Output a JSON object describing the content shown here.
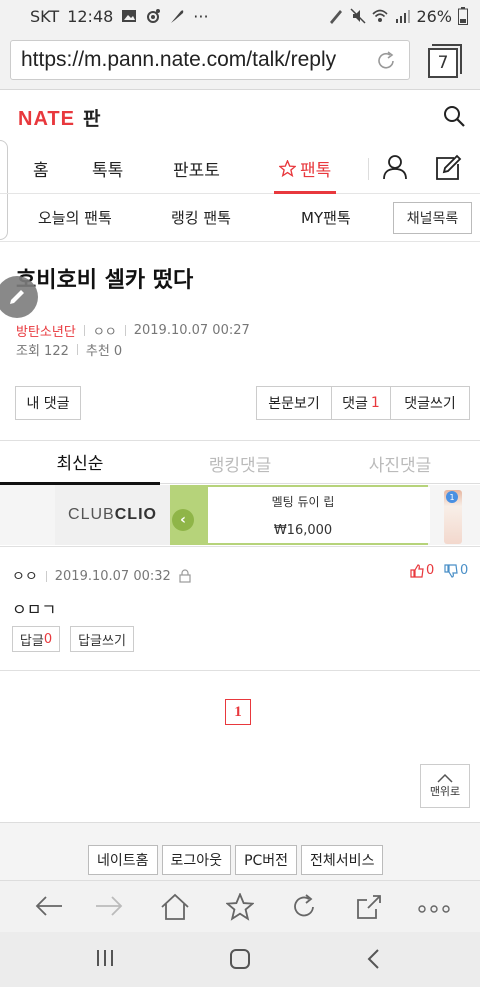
{
  "status_bar": {
    "carrier": "SKT",
    "time": "12:48",
    "more": "···",
    "battery": "26%"
  },
  "browser": {
    "url": "https://m.pann.nate.com/talk/reply",
    "tab_count": "7"
  },
  "site": {
    "logo": "NATE",
    "section": "판"
  },
  "main_nav": {
    "home": "홈",
    "toktok": "톡톡",
    "panpoto": "판포토",
    "pantalk": "팬톡"
  },
  "sub_nav": {
    "today": "오늘의 팬톡",
    "ranking": "랭킹 팬톡",
    "my": "MY팬톡",
    "channel_list": "채널목록"
  },
  "post": {
    "title": "호비호비 셀카 떴다",
    "author": "방탄소년단",
    "nickname": "ㅇㅇ",
    "datetime": "2019.10.07 00:27",
    "views": "조회 122",
    "recommends": "추천 0"
  },
  "actions": {
    "my_comments": "내 댓글",
    "view_post": "본문보기",
    "comments_label": "댓글",
    "comments_count": "1",
    "write_comment": "댓글쓰기"
  },
  "comment_tabs": [
    "최신순",
    "랭킹댓글",
    "사진댓글"
  ],
  "ad": {
    "brand_left": "CLUB",
    "brand_right": "CLIO",
    "product": "멜팅 듀이 립",
    "price": "₩16,000",
    "badge": "1"
  },
  "comments": [
    {
      "nickname": "ㅇㅇ",
      "datetime": "2019.10.07 00:32",
      "up": "0",
      "down": "0",
      "text": "ㅇㅁㄱ",
      "reply_label": "답글",
      "reply_count": "0",
      "reply_write": "답글쓰기"
    }
  ],
  "pagination": {
    "current": "1"
  },
  "top_button": "맨위로",
  "footer_links": [
    "네이트홈",
    "로그아웃",
    "PC버전",
    "전체서비스"
  ],
  "colors": {
    "accent": "#e8383d",
    "ad_green": "#b6d37a"
  }
}
